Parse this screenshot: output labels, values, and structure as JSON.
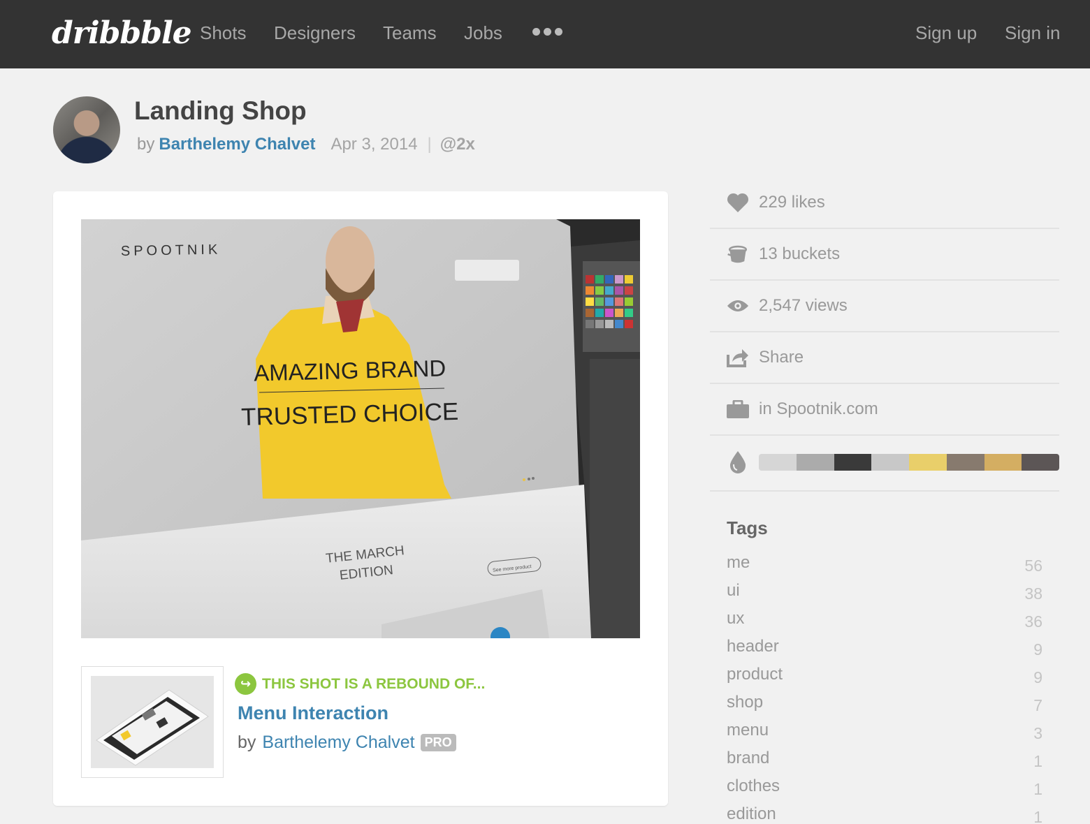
{
  "nav": {
    "logo": "dribbble",
    "links": [
      "Shots",
      "Designers",
      "Teams",
      "Jobs"
    ],
    "more_icon": "more-dots-icon",
    "sign_up": "Sign up",
    "sign_in": "Sign in"
  },
  "shot": {
    "title": "Landing Shop",
    "by": "by",
    "author": "Barthelemy Chalvet",
    "date": "Apr 3, 2014",
    "separator": "|",
    "resolution": "@2x"
  },
  "mockup": {
    "brand": "SPOOTNIK",
    "headline_1": "AMAZING BRAND",
    "headline_2": "TRUSTED CHOICE",
    "edition_1": "THE MARCH",
    "edition_2": "EDITION",
    "button": "See more product"
  },
  "rebound": {
    "heading": "THIS SHOT IS A REBOUND OF...",
    "title": "Menu Interaction",
    "by": "by",
    "author": "Barthelemy Chalvet",
    "badge": "PRO"
  },
  "stats": {
    "likes": "229 likes",
    "buckets": "13 buckets",
    "views": "2,547 views",
    "share": "Share",
    "project": "in Spootnik.com"
  },
  "palette": [
    "#d6d6d6",
    "#ababab",
    "#3a3a3a",
    "#c8c8c8",
    "#e9cf6a",
    "#877a6e",
    "#d4ae62",
    "#5c5656"
  ],
  "tags": {
    "title": "Tags",
    "items": [
      {
        "name": "me",
        "count": "56"
      },
      {
        "name": "ui",
        "count": "38"
      },
      {
        "name": "ux",
        "count": "36"
      },
      {
        "name": "header",
        "count": "9"
      },
      {
        "name": "product",
        "count": "9"
      },
      {
        "name": "shop",
        "count": "7"
      },
      {
        "name": "menu",
        "count": "3"
      },
      {
        "name": "brand",
        "count": "1"
      },
      {
        "name": "clothes",
        "count": "1"
      },
      {
        "name": "edition",
        "count": "1"
      }
    ]
  }
}
